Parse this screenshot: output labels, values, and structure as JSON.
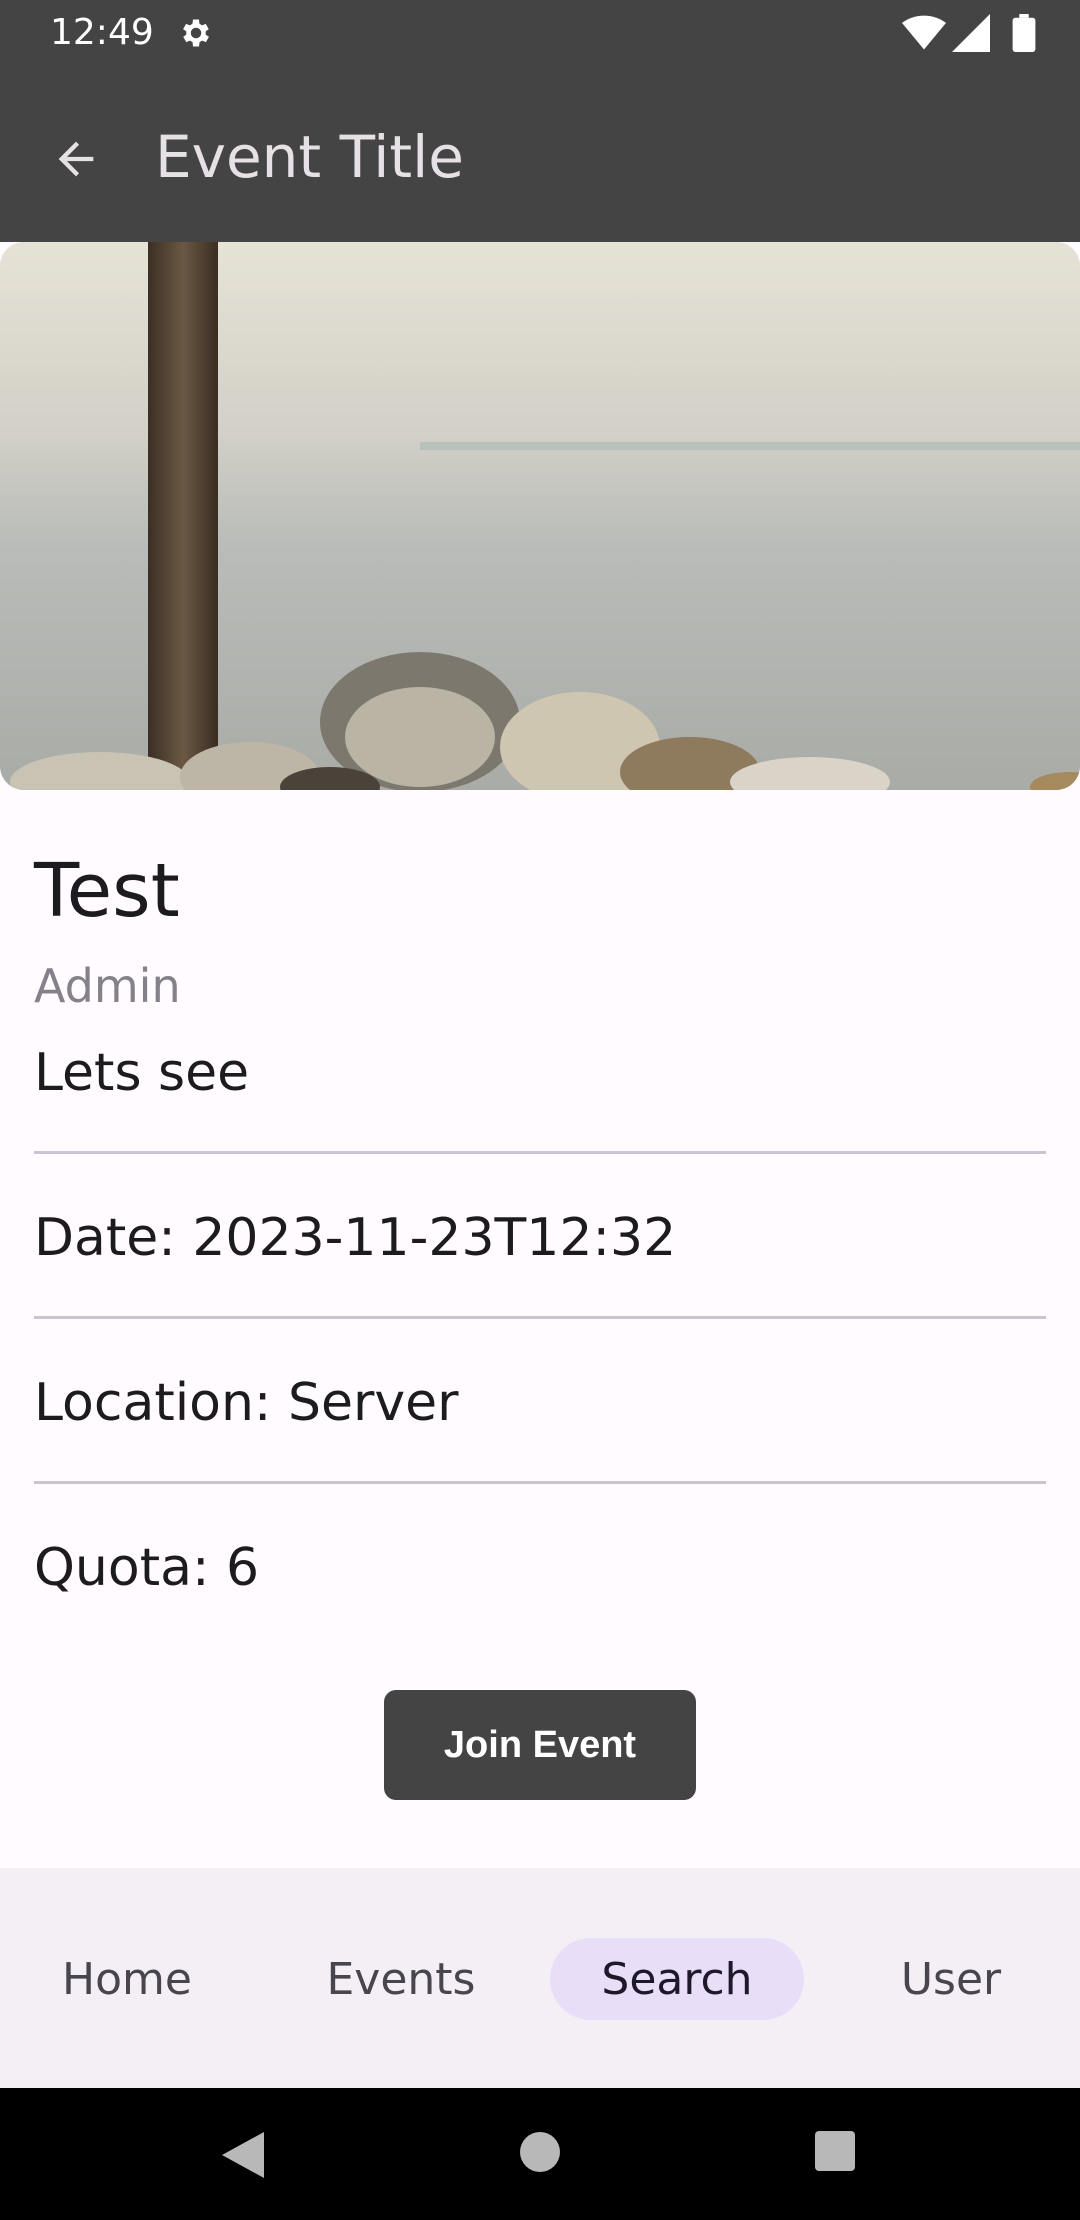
{
  "status_bar": {
    "time": "12:49",
    "icons": [
      "gear-icon",
      "wifi-icon",
      "signal-icon",
      "battery-icon"
    ]
  },
  "app_bar": {
    "title": "Event Title",
    "back_icon": "arrow-back-icon"
  },
  "event": {
    "name": "Test",
    "host": "Admin",
    "description": "Lets see",
    "date_line": "Date: 2023-11-23T12:32",
    "location_line": "Location: Server",
    "quota_line": "Quota: 6"
  },
  "actions": {
    "join_label": "Join Event"
  },
  "bottom_nav": {
    "items": [
      {
        "label": "Home"
      },
      {
        "label": "Events"
      },
      {
        "label": "Search",
        "selected": true
      },
      {
        "label": "User"
      }
    ]
  },
  "colors": {
    "app_bar": "#444444",
    "background": "#fffbfe",
    "nav_background": "#f3eff4",
    "nav_selected_pill": "#e8def8",
    "divider": "#cac4d0"
  }
}
